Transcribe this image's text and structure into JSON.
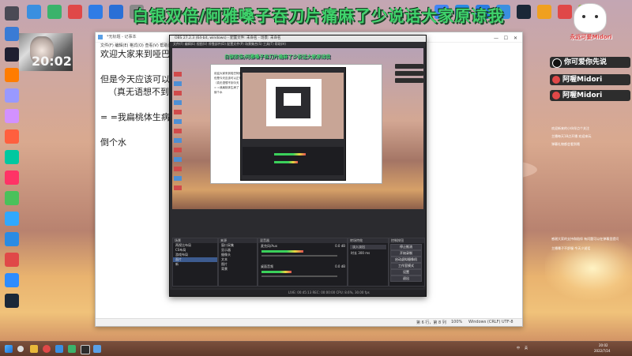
{
  "overlay": {
    "banner_text": "白银双倍/阿雅嗓子吞刀片痛麻了少说话大家原谅我",
    "cam_time": "20:02"
  },
  "right_panel": {
    "logo_line": "永远可爱Midori",
    "buttons": [
      "你可爱你先说",
      "阿喔Midori",
      "阿喔Midori"
    ],
    "chat_lines_a": [
      "欢迎新来的小伙伴点个关注",
      "主播每天18点开播 欢迎来玩",
      "弹幕礼物都会看到哦"
    ],
    "chat_lines_b": [
      "感谢大家的支持和陪伴 有问题可以在弹幕里提问",
      "主播嗓子不舒服 今天少说话"
    ]
  },
  "notepad": {
    "title": "*无标题 - 记事本",
    "menu": "文件(F) 编辑(E) 格式(O) 查看(V) 帮助(H)",
    "lines": [
      "欢迎大家来到哑巴阿雅的直播间，今天嗓子吞刀片了，已经吃了止痛药",
      "",
      "但是今天应该可以正常直播",
      "（真无语想不到今天",
      "",
      "= =我扁桃体生病了",
      "",
      "倒个水"
    ],
    "status": {
      "position": "第 6 行，第 8 列",
      "zoom": "100%",
      "eol": "Windows (CRLF)",
      "encoding": "UTF-8"
    },
    "min_symbol": "—",
    "max_symbol": "☐",
    "close_symbol": "✕"
  },
  "obs": {
    "title": "OBS 27.2.3 (64-bit, windows) - 配置文件: 未命名 - 场景: 未命名",
    "menu": "文件(F) 编辑(E) 视图(V) 停靠部件(D) 配置文件(P) 场景集合(S) 工具(T) 帮助(H)",
    "scenes_header": "场景",
    "sources_header": "来源",
    "mixer_header": "混音器",
    "transition_header": "转场特效",
    "controls_header": "控制按钮",
    "scenes": [
      "两视比布局",
      "CS布局",
      "游戏布局",
      "面片",
      "新"
    ],
    "sources": [
      "窗口采集",
      "显示器",
      "摄像头",
      "文本",
      "图片",
      "背景"
    ],
    "mixer": [
      {
        "name": "麦克风/Aux",
        "db": "0.0 dB",
        "level": 0.55
      },
      {
        "name": "桌面音频",
        "db": "0.0 dB",
        "level": 0.4
      }
    ],
    "transition": {
      "type": "淡入淡出",
      "duration_label": "时长",
      "duration": "300 ms"
    },
    "controls": [
      "停止推流",
      "开始录制",
      "启动虚拟摄像机",
      "工作室模式",
      "设置",
      "退出"
    ],
    "status": "LIVE: 00:45:13   REC: 00:00:00   CPU: 8.6%, 30.00 fps"
  },
  "nested_notepad": {
    "lines": [
      "欢迎大家来到哑巴阿雅的直播间",
      "但是今天应该可以正常直播",
      "（真无语想不到今天",
      "= =我扁桃体生病了",
      "倒个水"
    ]
  },
  "desktop_icons_left": [
    "回收站",
    "此电脑",
    "Photoshop",
    "Adobe Illustrator",
    "Premiere",
    "After Effects",
    "Animate",
    "Audition",
    "InDesign",
    "Dreamweaver",
    "Lightroom",
    "Edge",
    "网易云音乐",
    "Zoom",
    "Steam"
  ],
  "desktop_icons_top": [
    "QQ",
    "微信",
    "网易云",
    "百度网盘",
    "文档",
    "控制面板",
    "Chrome",
    "Edge",
    "酷狗",
    "迅雷",
    "Steam",
    "WeGame",
    "网易UU",
    "NVIDIA"
  ],
  "taskbar": {
    "clock": "20:02",
    "date": "2022/7/24",
    "lang": "中",
    "sys": "英"
  },
  "colors": {
    "banner": "#3fd36b",
    "obs_bg": "#2b2b2f",
    "taskbar": "#5e3a2b",
    "accent_red": "#e04848"
  }
}
